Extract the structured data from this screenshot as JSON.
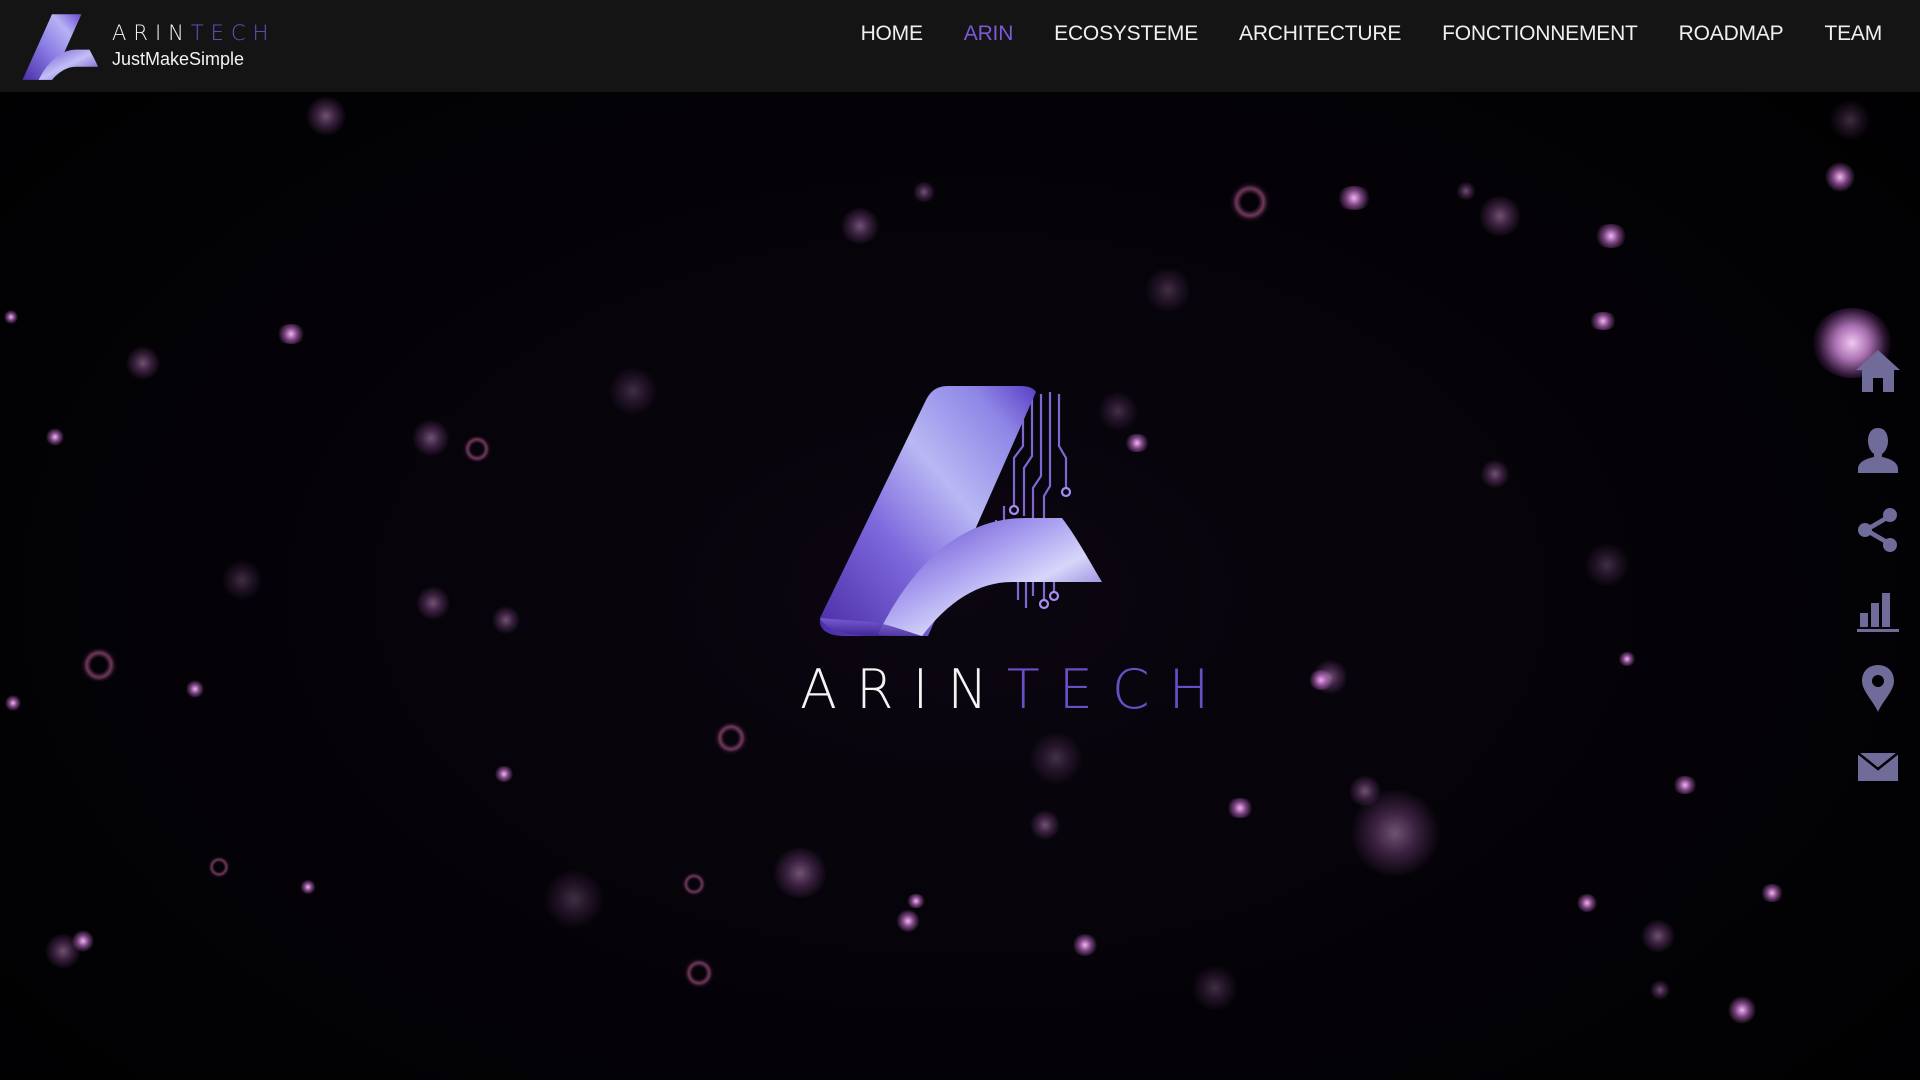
{
  "header": {
    "brand": {
      "name_part1": "ARIN",
      "name_part2": "TECH",
      "tagline": "JustMakeSimple",
      "logo_icon": "arintech-logo-icon"
    },
    "nav": [
      {
        "label": "HOME",
        "active": false
      },
      {
        "label": "ARIN",
        "active": true
      },
      {
        "label": "ECOSYSTEME",
        "active": false
      },
      {
        "label": "ARCHITECTURE",
        "active": false
      },
      {
        "label": "FONCTIONNEMENT",
        "active": false
      },
      {
        "label": "ROADMAP",
        "active": false
      },
      {
        "label": "TEAM",
        "active": false
      }
    ]
  },
  "hero": {
    "logo_icon": "arintech-logo-icon",
    "name_part1": "ARIN",
    "name_part2": "TECH"
  },
  "side_nav": [
    {
      "icon": "home-icon"
    },
    {
      "icon": "user-icon"
    },
    {
      "icon": "share-icon"
    },
    {
      "icon": "bar-chart-icon"
    },
    {
      "icon": "map-pin-icon"
    },
    {
      "icon": "mail-icon"
    }
  ],
  "colors": {
    "background": "#000000",
    "header_bg": "#141414",
    "accent_violet": "#7a5ad6",
    "nav_text": "#efefef",
    "side_icon": "#6f6c9a",
    "particle_pink": "#d98ae6"
  }
}
